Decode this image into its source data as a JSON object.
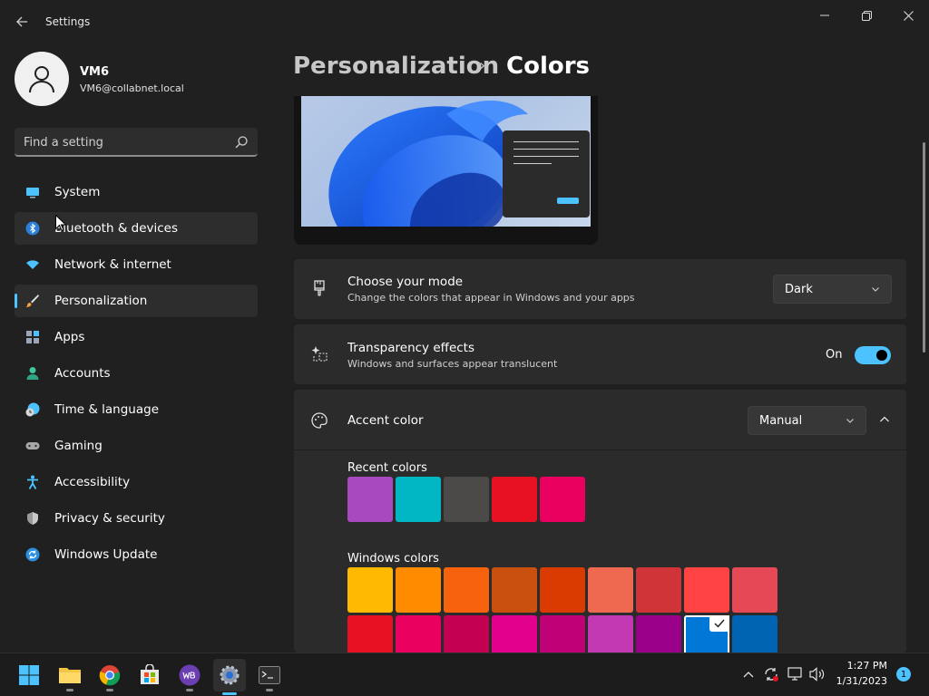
{
  "window": {
    "title": "Settings"
  },
  "profile": {
    "name": "VM6",
    "email": "VM6@collabnet.local"
  },
  "search": {
    "placeholder": "Find a setting"
  },
  "nav": {
    "items": [
      {
        "label": "System",
        "icon": "monitor-icon"
      },
      {
        "label": "Bluetooth & devices",
        "icon": "bluetooth-icon"
      },
      {
        "label": "Network & internet",
        "icon": "wifi-icon"
      },
      {
        "label": "Personalization",
        "icon": "brush-icon"
      },
      {
        "label": "Apps",
        "icon": "apps-icon"
      },
      {
        "label": "Accounts",
        "icon": "person-icon"
      },
      {
        "label": "Time & language",
        "icon": "clock-globe-icon"
      },
      {
        "label": "Gaming",
        "icon": "gamepad-icon"
      },
      {
        "label": "Accessibility",
        "icon": "accessibility-icon"
      },
      {
        "label": "Privacy & security",
        "icon": "shield-icon"
      },
      {
        "label": "Windows Update",
        "icon": "update-icon"
      }
    ]
  },
  "breadcrumb": {
    "parent": "Personalization",
    "separator": "›",
    "current": "Colors"
  },
  "mode": {
    "title": "Choose your mode",
    "description": "Change the colors that appear in Windows and your apps",
    "value": "Dark"
  },
  "transparency": {
    "title": "Transparency effects",
    "description": "Windows and surfaces appear translucent",
    "state_label": "On",
    "enabled": true
  },
  "accent": {
    "title": "Accent color",
    "value": "Manual"
  },
  "recent_colors": {
    "label": "Recent colors",
    "colors": [
      "#a849c0",
      "#00b7c3",
      "#4c4a48",
      "#e81123",
      "#ea005e"
    ]
  },
  "windows_colors": {
    "label": "Windows colors",
    "row1": [
      "#ffb900",
      "#ff8c00",
      "#f7630c",
      "#ca5010",
      "#da3b01",
      "#ef6950",
      "#d13438",
      "#ff4343",
      "#e74856"
    ],
    "row2": [
      "#e81123",
      "#ea005e",
      "#c30052",
      "#e3008c",
      "#bf0077",
      "#c239b3",
      "#9a0089",
      "#0078d7",
      "#0063b1"
    ],
    "selected_index_row2": 7
  },
  "taskbar": {
    "apps": [
      "start-icon",
      "file-explorer-icon",
      "chrome-icon",
      "store-icon",
      "web-app-icon",
      "settings-icon",
      "terminal-icon"
    ],
    "time": "1:27 PM",
    "date": "1/31/2023",
    "notification_count": "1"
  },
  "colors": {
    "accent": "#4cc2ff",
    "background": "#202020",
    "card": "#2b2b2b"
  }
}
